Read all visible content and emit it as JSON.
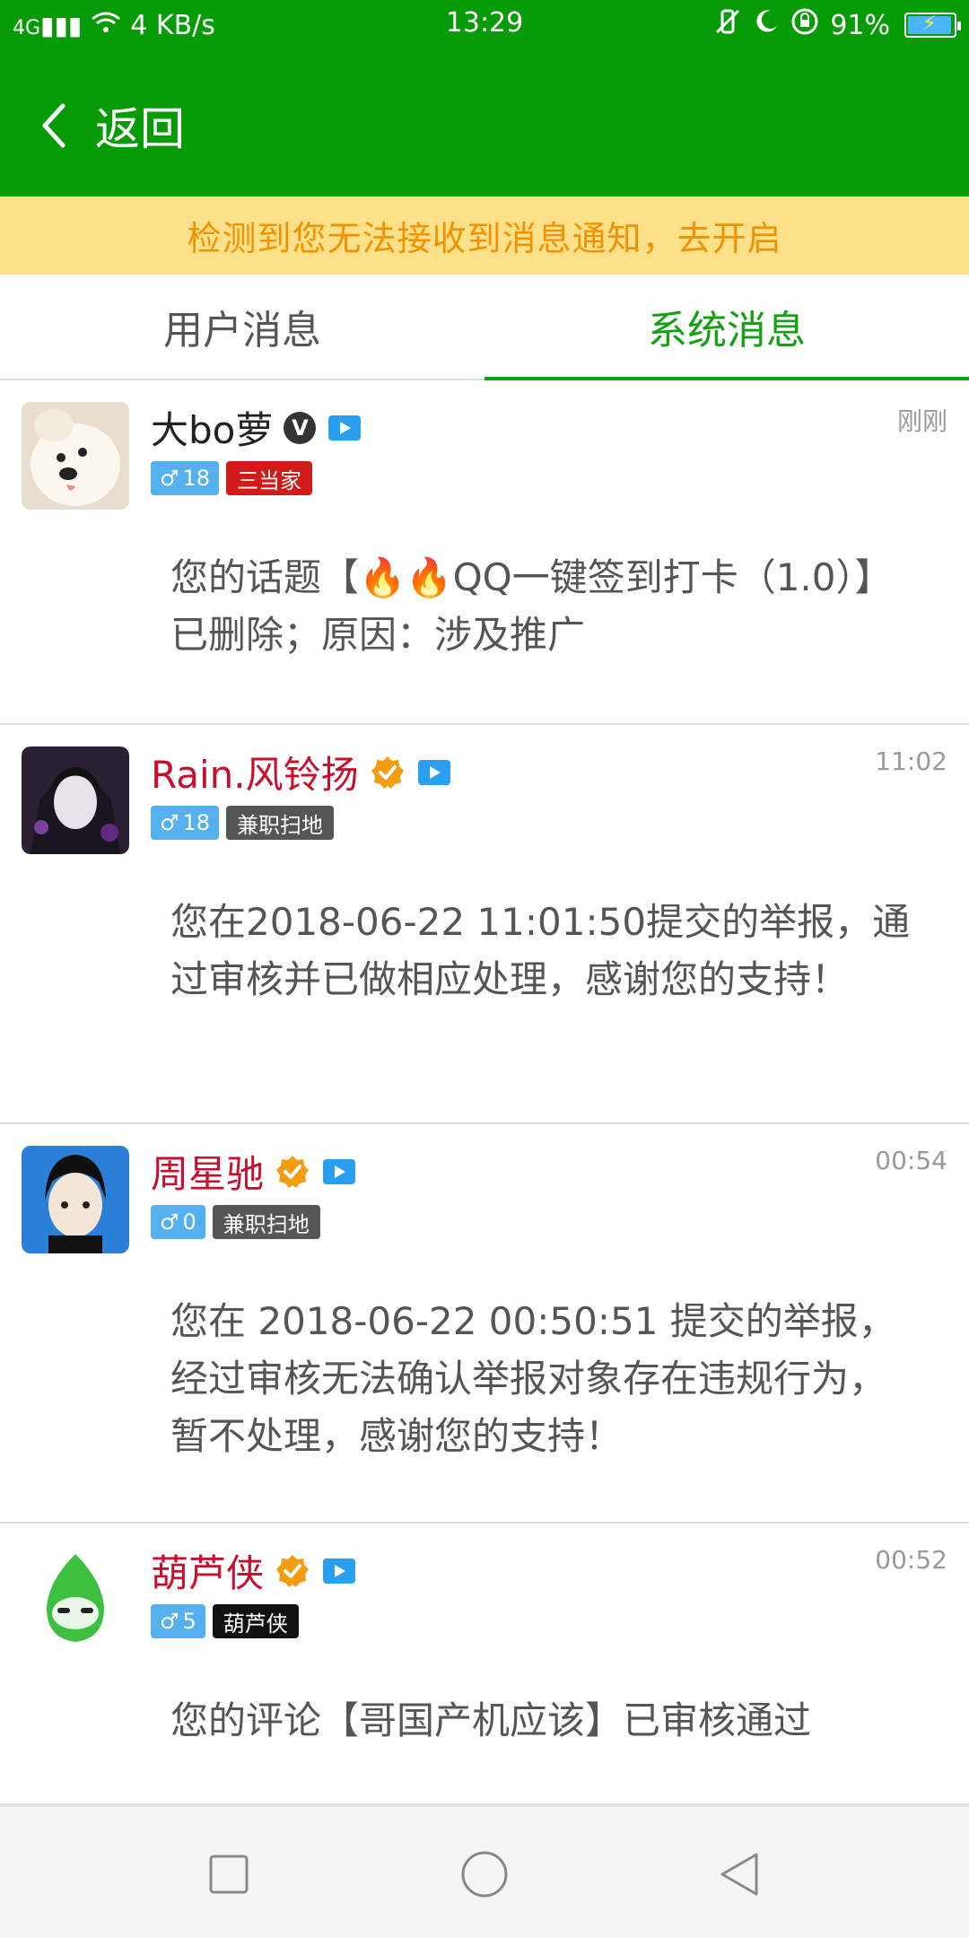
{
  "status_bar": {
    "signal": "4G",
    "speed": "4 KB/s",
    "time": "13:29",
    "tiny_label": "...",
    "battery": "91%"
  },
  "appbar": {
    "back_label": "返回"
  },
  "notice": "检测到您无法接收到消息通知，去开启",
  "tabs": {
    "user": "用户消息",
    "system": "系统消息"
  },
  "messages": [
    {
      "name": "大bo萝",
      "v_badge": "V",
      "gender": "♂",
      "level": "18",
      "role": "三当家",
      "role_color": "#d11a1a",
      "time": "刚刚",
      "text": "您的话题【🔥🔥QQ一键签到打卡（1.0）】已删除；原因：涉及推广"
    },
    {
      "name": "Rain.风铃扬",
      "gender": "♂",
      "level": "18",
      "role": "兼职扫地",
      "role_color": "#555555",
      "time": "11:02",
      "text": "您在2018-06-22 11:01:50提交的举报，通过审核并已做相应处理，感谢您的支持！"
    },
    {
      "name": "周星驰",
      "gender": "♂",
      "level": "0",
      "role": "兼职扫地",
      "role_color": "#555555",
      "time": "00:54",
      "text": "您在 2018-06-22 00:50:51 提交的举报，经过审核无法确认举报对象存在违规行为，暂不处理，感谢您的支持！"
    },
    {
      "name": "葫芦侠",
      "gender": "♂",
      "level": "5",
      "role": "葫芦侠",
      "role_color": "#111111",
      "time": "00:52",
      "text": "您的评论【哥国产机应该】已审核通过"
    }
  ],
  "colors": {
    "brand_green": "#079c07",
    "notice_bg": "#fde08a",
    "notice_text": "#f29200",
    "name_red": "#c8102e",
    "gender_blue": "#55b0ef"
  }
}
